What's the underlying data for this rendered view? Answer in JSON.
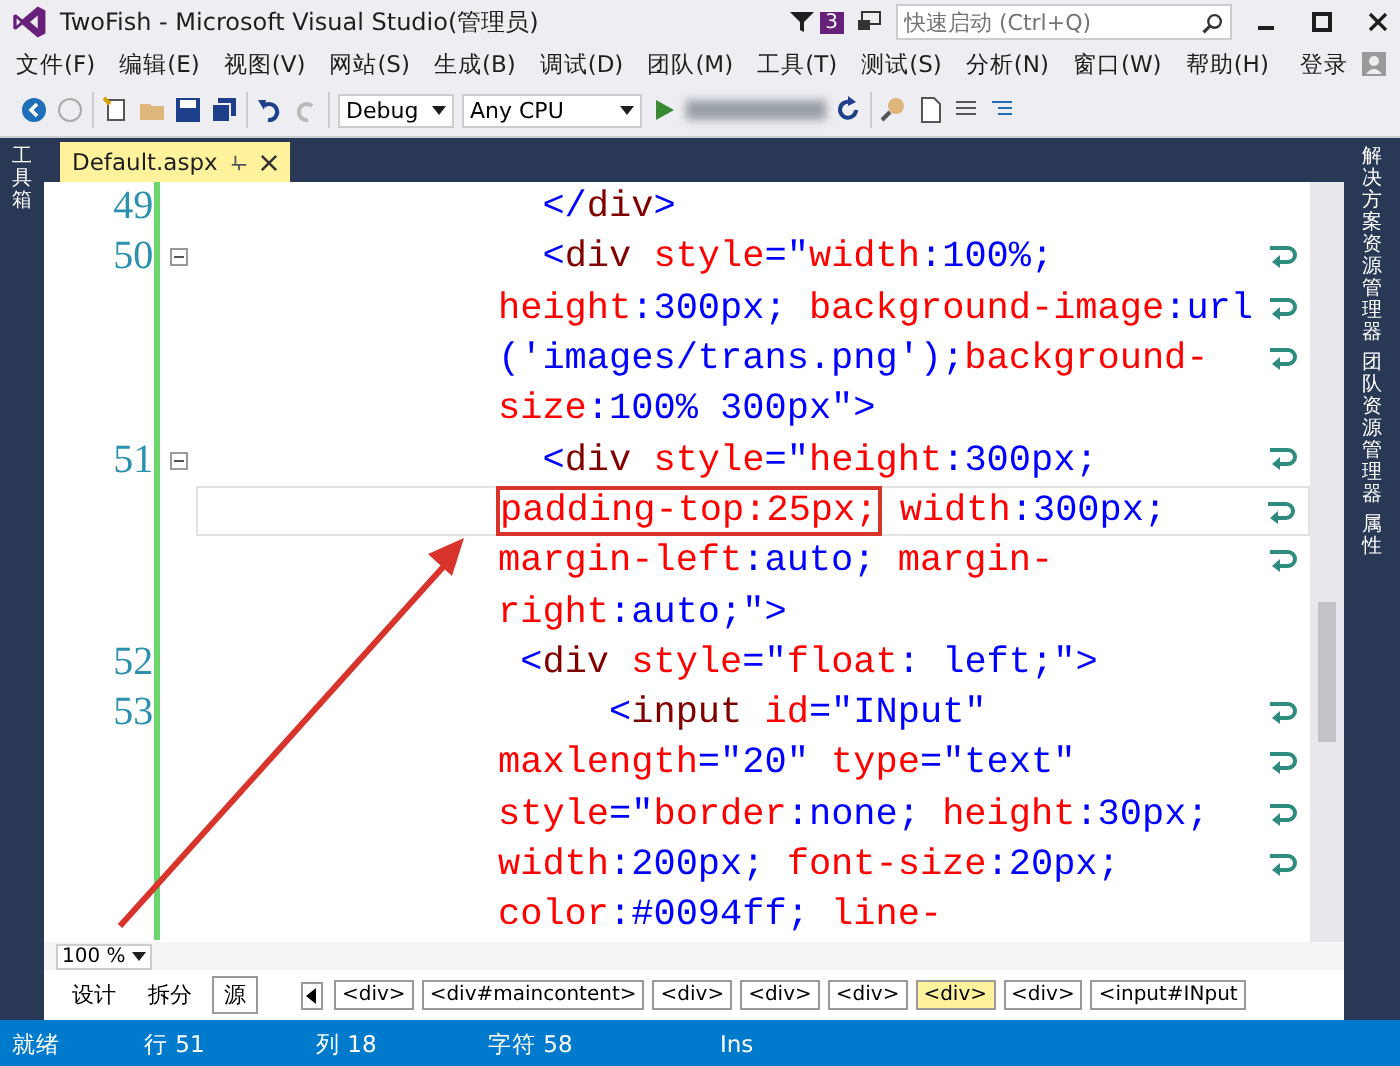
{
  "window": {
    "title": "TwoFish - Microsoft Visual Studio(管理员)",
    "notification_count": "3",
    "quick_launch": {
      "placeholder": "快速启动 (Ctrl+Q)"
    }
  },
  "menu": [
    "文件(F)",
    "编辑(E)",
    "视图(V)",
    "网站(S)",
    "生成(B)",
    "调试(D)",
    "团队(M)",
    "工具(T)",
    "测试(S)",
    "分析(N)",
    "窗口(W)",
    "帮助(H)"
  ],
  "sign_in": "登录",
  "toolbar": {
    "configuration": "Debug",
    "platform": "Any CPU"
  },
  "left_panel": "工具箱",
  "right_panels": [
    "解决方案资源管理器",
    "团队资源管理器",
    "属性"
  ],
  "tabs": [
    {
      "label": "Default.aspx",
      "selected": true
    }
  ],
  "code_rows": [
    {
      "line": "49",
      "fold": false,
      "current": false,
      "wrapped": false,
      "segments": [
        {
          "text": "  </",
          "kind": "punct"
        },
        {
          "text": "div",
          "kind": "tag"
        },
        {
          "text": ">",
          "kind": "punct"
        }
      ]
    },
    {
      "line": "50",
      "fold": true,
      "current": false,
      "wrapped": true,
      "segments": [
        {
          "text": "  <",
          "kind": "punct"
        },
        {
          "text": "div",
          "kind": "tag"
        },
        {
          "text": " style",
          "kind": "attr"
        },
        {
          "text": "=\"",
          "kind": "punct"
        },
        {
          "text": "width",
          "kind": "prop"
        },
        {
          "text": ":100%;",
          "kind": "value"
        }
      ]
    },
    {
      "fold": false,
      "current": false,
      "wrapped": true,
      "segments": [
        {
          "text": "height",
          "kind": "prop"
        },
        {
          "text": ":300px; ",
          "kind": "value"
        },
        {
          "text": "background-image",
          "kind": "prop"
        },
        {
          "text": ":url",
          "kind": "value"
        }
      ]
    },
    {
      "fold": false,
      "current": false,
      "wrapped": true,
      "segments": [
        {
          "text": "('images/trans.png');",
          "kind": "value"
        },
        {
          "text": "background-",
          "kind": "prop"
        }
      ]
    },
    {
      "fold": false,
      "current": false,
      "wrapped": false,
      "segments": [
        {
          "text": "size",
          "kind": "prop"
        },
        {
          "text": ":100% 300px",
          "kind": "value"
        },
        {
          "text": "\">",
          "kind": "punct"
        }
      ]
    },
    {
      "line": "51",
      "fold": true,
      "current": false,
      "wrapped": true,
      "segments": [
        {
          "text": "  <",
          "kind": "punct"
        },
        {
          "text": "div",
          "kind": "tag"
        },
        {
          "text": " style",
          "kind": "attr"
        },
        {
          "text": "=\"",
          "kind": "punct"
        },
        {
          "text": "height",
          "kind": "prop"
        },
        {
          "text": ":300px;",
          "kind": "value"
        }
      ]
    },
    {
      "fold": false,
      "current": true,
      "wrapped": true,
      "segments": [
        {
          "text": "padding-top:25px;",
          "kind": "prop",
          "boxed": true
        },
        {
          "text": " width",
          "kind": "prop"
        },
        {
          "text": ":300px;",
          "kind": "value"
        }
      ]
    },
    {
      "fold": false,
      "current": false,
      "wrapped": true,
      "segments": [
        {
          "text": "margin-left",
          "kind": "prop"
        },
        {
          "text": ":auto; ",
          "kind": "value"
        },
        {
          "text": "margin-",
          "kind": "prop"
        }
      ]
    },
    {
      "fold": false,
      "current": false,
      "wrapped": false,
      "segments": [
        {
          "text": "right",
          "kind": "prop"
        },
        {
          "text": ":auto;",
          "kind": "value"
        },
        {
          "text": "\">",
          "kind": "punct"
        }
      ]
    },
    {
      "line": "52",
      "fold": false,
      "current": false,
      "wrapped": false,
      "segments": [
        {
          "text": " <",
          "kind": "punct"
        },
        {
          "text": "div",
          "kind": "tag"
        },
        {
          "text": " style",
          "kind": "attr"
        },
        {
          "text": "=\"",
          "kind": "punct"
        },
        {
          "text": "float",
          "kind": "prop"
        },
        {
          "text": ": left;",
          "kind": "value"
        },
        {
          "text": "\">",
          "kind": "punct"
        }
      ]
    },
    {
      "line": "53",
      "fold": false,
      "current": false,
      "wrapped": true,
      "segments": [
        {
          "text": "     <",
          "kind": "punct"
        },
        {
          "text": "input",
          "kind": "tag"
        },
        {
          "text": " id",
          "kind": "attr"
        },
        {
          "text": "=\"INput\"",
          "kind": "value"
        }
      ]
    },
    {
      "fold": false,
      "current": false,
      "wrapped": true,
      "segments": [
        {
          "text": "maxlength",
          "kind": "attr"
        },
        {
          "text": "=\"20\" ",
          "kind": "value"
        },
        {
          "text": "type",
          "kind": "attr"
        },
        {
          "text": "=\"text\"",
          "kind": "value"
        }
      ]
    },
    {
      "fold": false,
      "current": false,
      "wrapped": true,
      "segments": [
        {
          "text": "style",
          "kind": "attr"
        },
        {
          "text": "=\"",
          "kind": "punct"
        },
        {
          "text": "border",
          "kind": "prop"
        },
        {
          "text": ":none; ",
          "kind": "value"
        },
        {
          "text": "height",
          "kind": "prop"
        },
        {
          "text": ":30px;",
          "kind": "value"
        }
      ]
    },
    {
      "fold": false,
      "current": false,
      "wrapped": true,
      "segments": [
        {
          "text": "width",
          "kind": "prop"
        },
        {
          "text": ":200px; ",
          "kind": "value"
        },
        {
          "text": "font-size",
          "kind": "prop"
        },
        {
          "text": ":20px;",
          "kind": "value"
        }
      ]
    },
    {
      "fold": false,
      "current": false,
      "wrapped": false,
      "segments": [
        {
          "text": "color",
          "kind": "prop"
        },
        {
          "text": ":#0094ff; ",
          "kind": "value"
        },
        {
          "text": "line-",
          "kind": "prop"
        }
      ]
    }
  ],
  "zoom": "100 %",
  "view_modes": [
    {
      "label": "设计",
      "selected": false
    },
    {
      "label": "拆分",
      "selected": false
    },
    {
      "label": "源",
      "selected": true
    }
  ],
  "breadcrumbs": [
    {
      "label": "<div>",
      "selected": false
    },
    {
      "label": "<div#maincontent>",
      "selected": false
    },
    {
      "label": "<div>",
      "selected": false
    },
    {
      "label": "<div>",
      "selected": false
    },
    {
      "label": "<div>",
      "selected": false
    },
    {
      "label": "<div>",
      "selected": true
    },
    {
      "label": "<div>",
      "selected": false
    },
    {
      "label": "<input#INput",
      "selected": false
    }
  ],
  "status_bar": {
    "state": "就绪",
    "line": "行 51",
    "column": "列 18",
    "char": "字符 58",
    "mode": "Ins"
  }
}
